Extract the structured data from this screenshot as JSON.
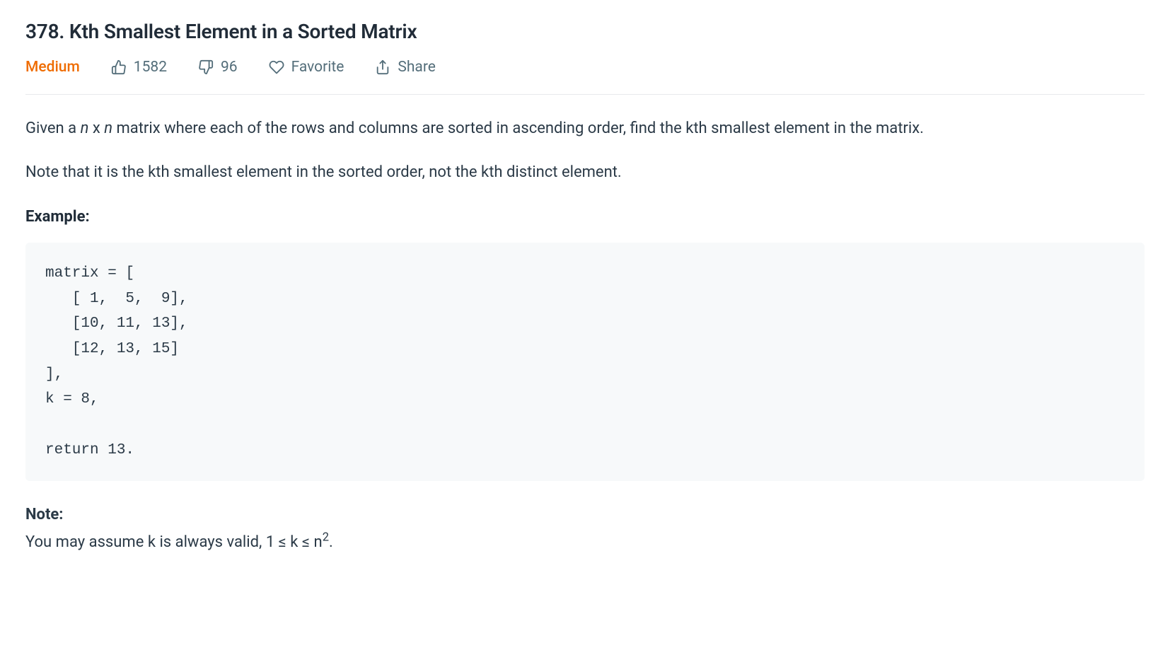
{
  "title": "378. Kth Smallest Element in a Sorted Matrix",
  "meta": {
    "difficulty": "Medium",
    "likes": "1582",
    "dislikes": "96",
    "favorite": "Favorite",
    "share": "Share"
  },
  "paragraphs": {
    "p1_a": "Given a ",
    "p1_em": "n",
    "p1_b": " x ",
    "p1_em2": "n",
    "p1_c": " matrix where each of the rows and columns are sorted in ascending order, find the kth smallest element in the matrix.",
    "p2": "Note that it is the kth smallest element in the sorted order, not the kth distinct element."
  },
  "example_label": "Example:",
  "example_code": "matrix = [\n   [ 1,  5,  9],\n   [10, 11, 13],\n   [12, 13, 15]\n],\nk = 8,\n\nreturn 13.",
  "note": {
    "label": "Note:",
    "text_a": "You may assume k is always valid, 1 ≤ k ≤ n",
    "sup": "2",
    "text_b": "."
  }
}
